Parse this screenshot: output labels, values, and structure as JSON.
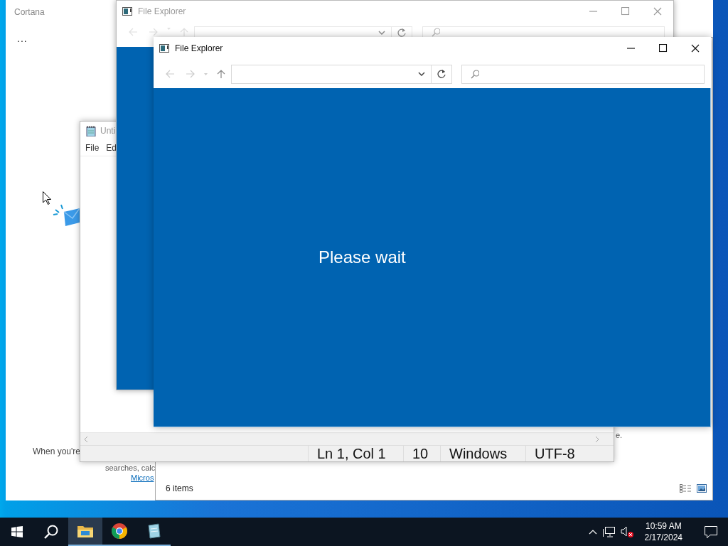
{
  "cortana": {
    "title": "Cortana",
    "more": "...",
    "fragment": "e.",
    "message": "When you're",
    "message_2": "searches, calc",
    "link": "Micros"
  },
  "explorer_back": {
    "title": "File Explorer"
  },
  "notepad": {
    "title": "Unti",
    "menu": [
      "File",
      "Ed"
    ],
    "status": [
      "Ln 1, Col 1",
      "10",
      "Windows",
      "UTF-8"
    ]
  },
  "explorer_front": {
    "title": "File Explorer",
    "message": "Please wait",
    "status": "6 items"
  },
  "taskbar": {
    "apps": [
      {
        "kind": "explorer",
        "selected": true
      },
      {
        "kind": "chrome",
        "selected": false
      },
      {
        "kind": "notepad",
        "selected": false
      }
    ],
    "time": "10:59 AM",
    "date": "2/17/2024"
  }
}
